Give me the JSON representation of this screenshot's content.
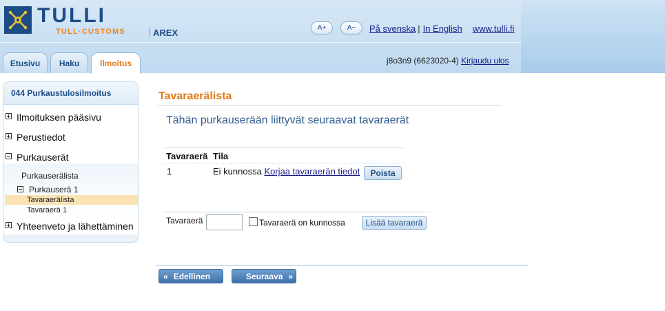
{
  "header": {
    "logo_text": "TULLI",
    "logo_subtext": "TULL·CUSTOMS",
    "app_name": "AREX",
    "font_increase": "A+",
    "font_decrease": "A−",
    "link_swedish": "På svenska",
    "sep1": "|",
    "link_english": "In English",
    "link_site": "www.tulli.fi"
  },
  "tabs": [
    {
      "label": "Etusivu"
    },
    {
      "label": "Haku"
    },
    {
      "label": "Ilmoitus"
    }
  ],
  "user": {
    "id": "j8o3n9 (6623020-4)",
    "logout": "Kirjaudu ulos"
  },
  "sidebar": {
    "title": "044 Purkaustulosilmoitus",
    "items": [
      {
        "label": "Ilmoituksen pääsivu",
        "state": "collapsed"
      },
      {
        "label": "Perustiedot",
        "state": "collapsed"
      },
      {
        "label": "Purkauserät",
        "state": "expanded"
      },
      {
        "label": "Yhteenveto ja lähettäminen",
        "state": "collapsed"
      }
    ],
    "sub": {
      "list_link": "Purkauserälista",
      "batch": "Purkauserä 1",
      "selected": "Tavaraerälista",
      "item": "Tavaraerä 1"
    }
  },
  "main": {
    "title": "Tavaraerälista",
    "intro": "Tähän purkauserään liittyvät seuraavat tavaraerät",
    "table": {
      "headers": [
        "Tavaraerä",
        "Tila"
      ],
      "rows": [
        {
          "number": "1",
          "status": "Ei kunnossa",
          "fix_link": "Korjaa tavaraerän tiedot",
          "delete": "Poista"
        }
      ]
    },
    "form": {
      "label_item": "Tavaraerä",
      "input_value": "",
      "checkbox_label": "Tavaraerä on kunnossa",
      "add_button": "Lisää tavaraerä"
    },
    "nav": {
      "prev": "Edellinen",
      "next": "Seuraava"
    }
  },
  "colors": {
    "brand_blue": "#1d4c86",
    "accent_orange": "#e07a1a",
    "header_bg": "#bed9f0"
  }
}
